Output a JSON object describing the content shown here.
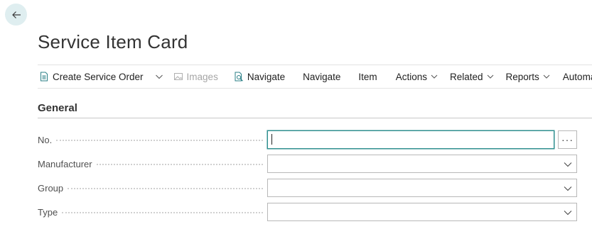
{
  "header": {
    "back_icon": "arrow-left-icon",
    "title": "Service Item Card"
  },
  "action_bar": {
    "create_service_order": "Create Service Order",
    "images": "Images",
    "navigate_1": "Navigate",
    "navigate_2": "Navigate",
    "item": "Item",
    "actions": "Actions",
    "related": "Related",
    "reports": "Reports",
    "automate": "Automate"
  },
  "section": {
    "title": "General"
  },
  "fields": {
    "no": {
      "label": "No.",
      "value": ""
    },
    "manufacturer": {
      "label": "Manufacturer",
      "value": ""
    },
    "group": {
      "label": "Group",
      "value": ""
    },
    "type": {
      "label": "Type",
      "value": ""
    }
  },
  "lookup_label": "···",
  "colors": {
    "accent": "#2f8f8f",
    "back_bg": "#dfeef0"
  }
}
